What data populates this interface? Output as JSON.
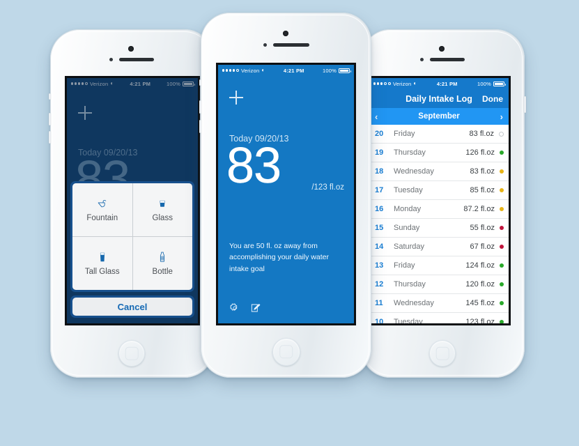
{
  "page": {
    "background": "#bfd8e8"
  },
  "status_bar": {
    "carrier": "Verizon",
    "time": "4:21 PM",
    "battery": "100%",
    "wifi_icon": "wifi-icon",
    "signal_icon": "signal-dots-icon",
    "battery_icon": "battery-full-icon"
  },
  "phone_left": {
    "name": "Add Intake — action sheet",
    "screen_bg": "#1b4c7d",
    "add_icon": "plus-icon",
    "today_label": "Today 09/20/13",
    "amount": "83",
    "sheet": {
      "options": [
        {
          "label": "Fountain",
          "icon": "water-fountain-icon"
        },
        {
          "label": "Glass",
          "icon": "glass-icon"
        },
        {
          "label": "Tall Glass",
          "icon": "tall-glass-icon"
        },
        {
          "label": "Bottle",
          "icon": "bottle-icon"
        }
      ],
      "cancel_label": "Cancel",
      "cancel_color": "#1569b4"
    }
  },
  "phone_center": {
    "name": "Daily intake home",
    "screen_bg": "#1478c3",
    "add_icon": "plus-icon",
    "today_label": "Today 09/20/13",
    "amount": "83",
    "goal_label": "/123 fl.oz",
    "message": "You are 50 fl. oz away from accomplishing your daily water intake goal",
    "toolbar": [
      {
        "icon": "gear-icon",
        "name": "settings-button"
      },
      {
        "icon": "compose-icon",
        "name": "edit-log-button"
      }
    ]
  },
  "phone_right": {
    "name": "Daily Intake Log",
    "nav": {
      "title": "Daily Intake Log",
      "done_label": "Done",
      "nav_bg": "#1579cb"
    },
    "month_bar": {
      "month": "September",
      "prev_icon": "chevron-left-icon",
      "next_icon": "chevron-right-icon",
      "bg": "#2196f3"
    },
    "columns": [
      "day",
      "weekday",
      "amount",
      "status"
    ],
    "rows": [
      {
        "day": "20",
        "weekday": "Friday",
        "amount": "83 fl.oz",
        "status": "none",
        "dot": "#ffffff"
      },
      {
        "day": "19",
        "weekday": "Thursday",
        "amount": "126 fl.oz",
        "status": "good",
        "dot": "#2aa82a"
      },
      {
        "day": "18",
        "weekday": "Wednesday",
        "amount": "83 fl.oz",
        "status": "low",
        "dot": "#e8b417"
      },
      {
        "day": "17",
        "weekday": "Tuesday",
        "amount": "85 fl.oz",
        "status": "low",
        "dot": "#e8b417"
      },
      {
        "day": "16",
        "weekday": "Monday",
        "amount": "87.2 fl.oz",
        "status": "low",
        "dot": "#e8b417"
      },
      {
        "day": "15",
        "weekday": "Sunday",
        "amount": "55 fl.oz",
        "status": "poor",
        "dot": "#c0143c"
      },
      {
        "day": "14",
        "weekday": "Saturday",
        "amount": "67 fl.oz",
        "status": "poor",
        "dot": "#c0143c"
      },
      {
        "day": "13",
        "weekday": "Friday",
        "amount": "124 fl.oz",
        "status": "good",
        "dot": "#2aa82a"
      },
      {
        "day": "12",
        "weekday": "Thursday",
        "amount": "120 fl.oz",
        "status": "good",
        "dot": "#2aa82a"
      },
      {
        "day": "11",
        "weekday": "Wednesday",
        "amount": "145 fl.oz",
        "status": "good",
        "dot": "#2aa82a"
      },
      {
        "day": "10",
        "weekday": "Tuesday",
        "amount": "123 fl.oz",
        "status": "good",
        "dot": "#2aa82a"
      }
    ]
  }
}
